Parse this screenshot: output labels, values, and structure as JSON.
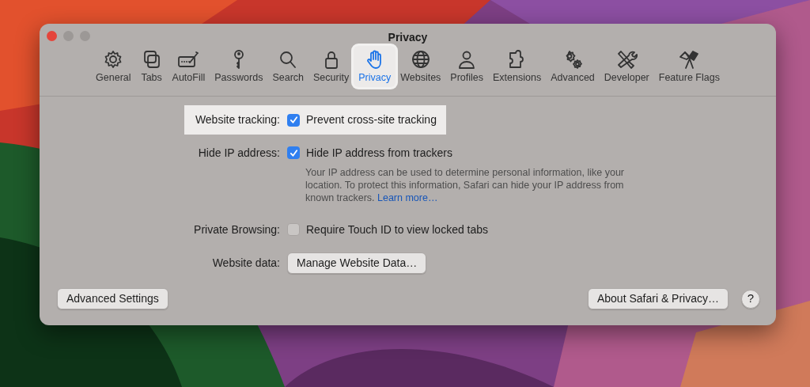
{
  "window": {
    "title": "Privacy"
  },
  "tabs": [
    {
      "label": "General",
      "selected": false
    },
    {
      "label": "Tabs",
      "selected": false
    },
    {
      "label": "AutoFill",
      "selected": false
    },
    {
      "label": "Passwords",
      "selected": false
    },
    {
      "label": "Search",
      "selected": false
    },
    {
      "label": "Security",
      "selected": false
    },
    {
      "label": "Privacy",
      "selected": true
    },
    {
      "label": "Websites",
      "selected": false
    },
    {
      "label": "Profiles",
      "selected": false
    },
    {
      "label": "Extensions",
      "selected": false
    },
    {
      "label": "Advanced",
      "selected": false
    },
    {
      "label": "Developer",
      "selected": false
    },
    {
      "label": "Feature Flags",
      "selected": false
    }
  ],
  "settings": [
    {
      "kind": "checkbox",
      "label": "Website tracking:",
      "text": "Prevent cross-site tracking",
      "checked": true,
      "highlighted": true
    },
    {
      "kind": "checkbox",
      "label": "Hide IP address:",
      "text": "Hide IP address from trackers",
      "checked": true,
      "highlighted": false,
      "description": "Your IP address can be used to determine personal information, like your location. To protect this information, Safari can hide your IP address from known trackers.",
      "link": "Learn more…"
    },
    {
      "kind": "checkbox",
      "label": "Private Browsing:",
      "text": "Require Touch ID to view locked tabs",
      "checked": false,
      "highlighted": false
    },
    {
      "kind": "button",
      "label": "Website data:",
      "text": "Manage Website Data…",
      "highlighted": false
    }
  ],
  "footer": {
    "left_button": "Advanced Settings",
    "right_button": "About Safari & Privacy…",
    "help": "?"
  }
}
